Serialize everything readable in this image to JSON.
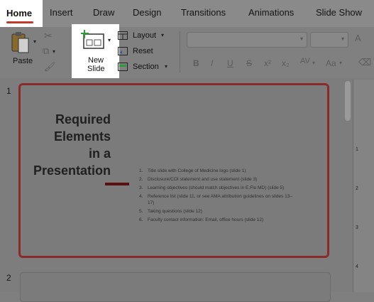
{
  "tabs": [
    {
      "label": "Home"
    },
    {
      "label": "Insert"
    },
    {
      "label": "Draw"
    },
    {
      "label": "Design"
    },
    {
      "label": "Transitions"
    },
    {
      "label": "Animations"
    },
    {
      "label": "Slide Show"
    }
  ],
  "ribbon": {
    "paste_label": "Paste",
    "new_slide_label_line1": "New",
    "new_slide_label_line2": "Slide",
    "layout_label": "Layout",
    "reset_label": "Reset",
    "section_label": "Section",
    "font_buttons": [
      "B",
      "I",
      "U",
      "S",
      "x²",
      "x₂",
      "AV",
      "Aa"
    ]
  },
  "slides": {
    "slide1_number": "1",
    "slide2_number": "2",
    "title": [
      "Required",
      "Elements",
      "in a",
      "Presentation"
    ],
    "bullets": [
      {
        "num": "1.",
        "text": "Title slide with College of Medicine logo (slide 1)"
      },
      {
        "num": "2.",
        "text": "Disclosure/COI statement and use statement  (slide 3)"
      },
      {
        "num": "3.",
        "text": "Learning objectives (should match objectives in E.Flo MD) (slide 5)"
      },
      {
        "num": "4.",
        "text": "Reference list (slide 11, or see AMA attribution guidelines on slides 13–17)"
      },
      {
        "num": "5.",
        "text": "Taking questions (slide 12)"
      },
      {
        "num": "6.",
        "text": "Faculty contact information: Email, office hours (slide 12)"
      }
    ]
  },
  "ruler": {
    "labels": [
      "1",
      "2",
      "3",
      "4"
    ]
  },
  "colors": {
    "accent": "#c0392b",
    "slide_border": "#8b2a2a",
    "title_bar": "#5a1010"
  }
}
